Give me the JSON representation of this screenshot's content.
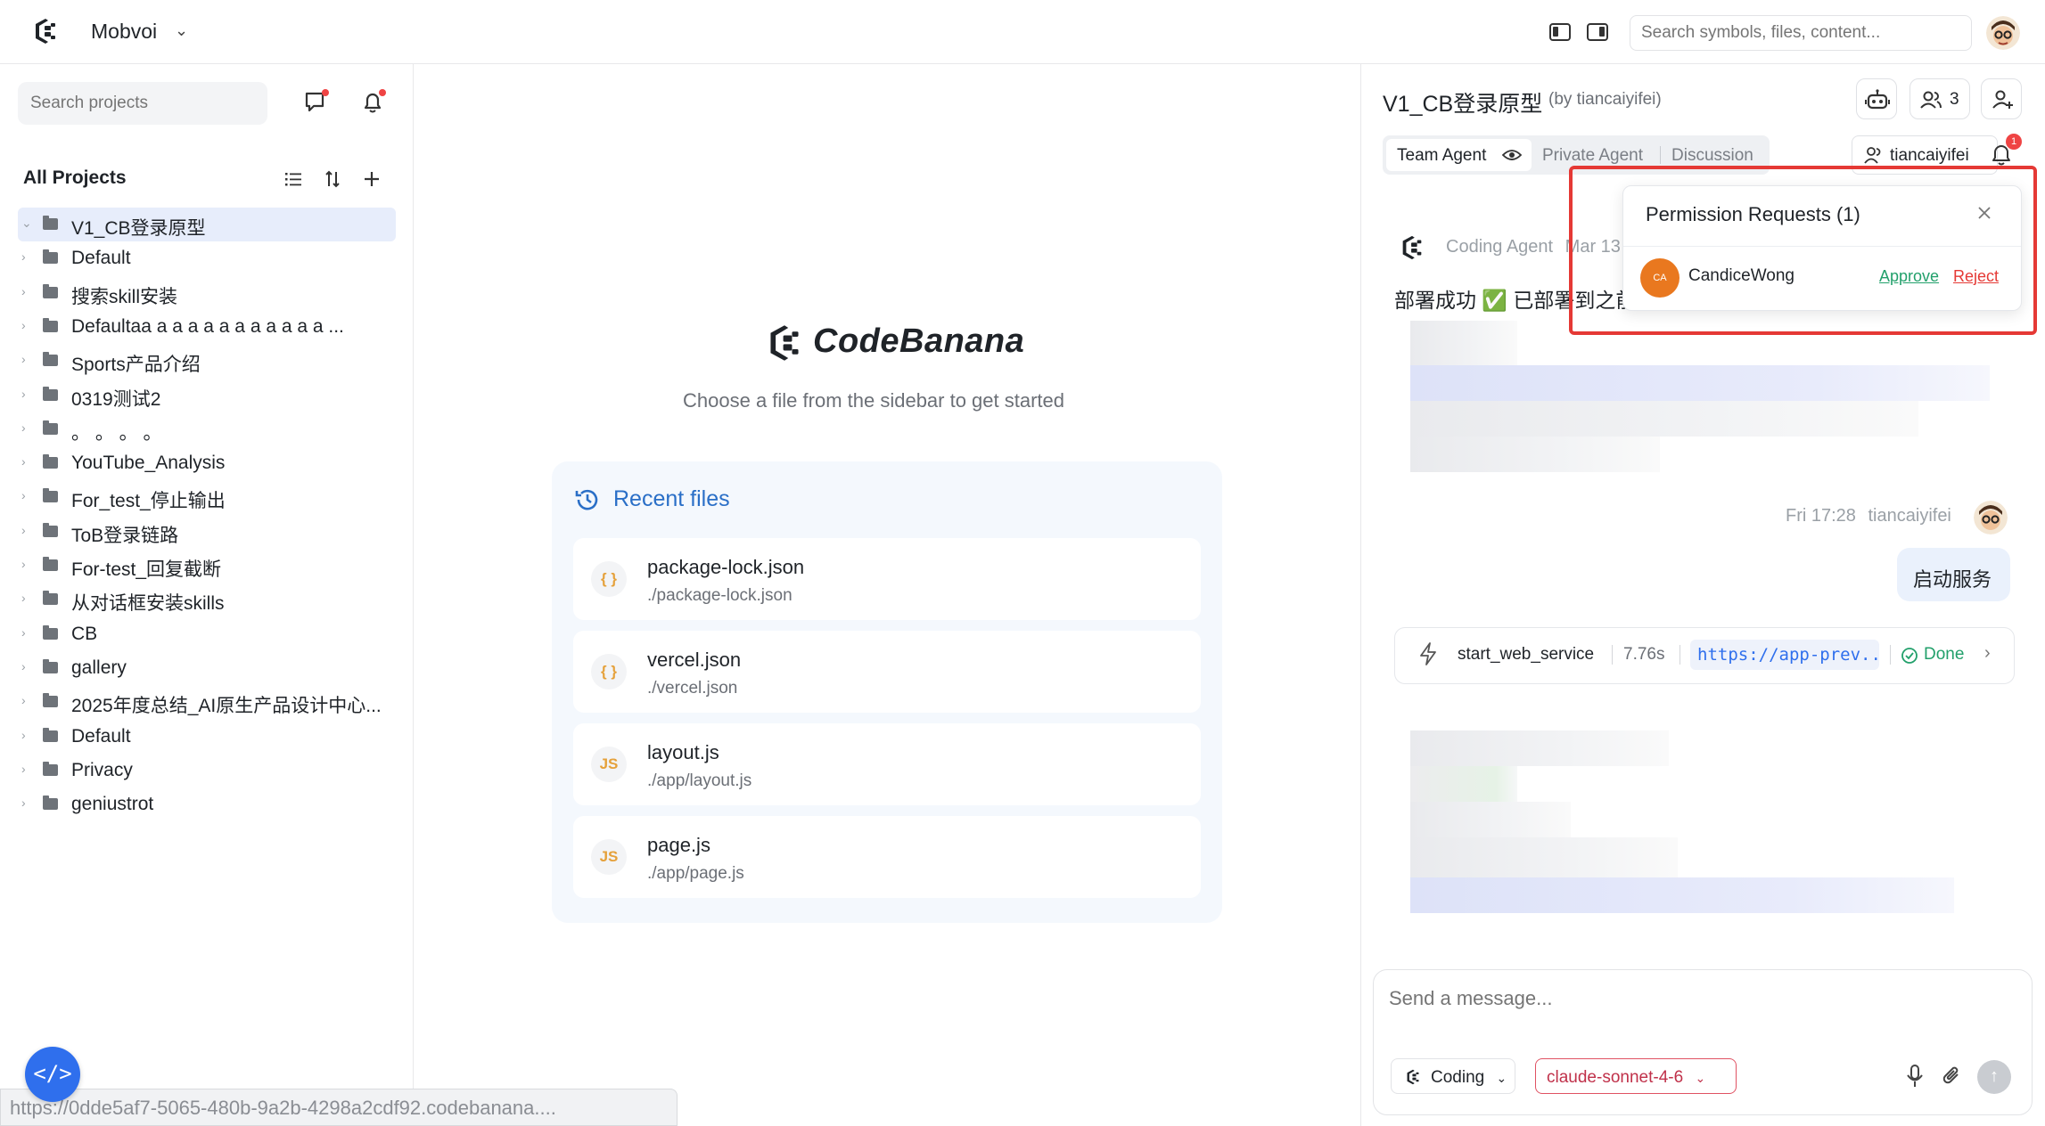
{
  "app": {
    "workspace_name": "Mobvoi",
    "global_search_placeholder": "Search symbols, files, content..."
  },
  "sidebar": {
    "search_placeholder": "Search projects",
    "section_title": "All Projects",
    "projects": [
      {
        "name": "V1_CB登录原型",
        "selected": true
      },
      {
        "name": "Default"
      },
      {
        "name": "搜索skill安装"
      },
      {
        "name": "Defaultaa a a a a a a a a a a a ..."
      },
      {
        "name": "Sports产品介绍"
      },
      {
        "name": "0319测试2"
      },
      {
        "name": "。 。 。 。"
      },
      {
        "name": "YouTube_Analysis"
      },
      {
        "name": "For_test_停止输出"
      },
      {
        "name": "ToB登录链路"
      },
      {
        "name": "For-test_回复截断"
      },
      {
        "name": "从对话框安装skills"
      },
      {
        "name": "CB"
      },
      {
        "name": "gallery"
      },
      {
        "name": "2025年度总结_AI原生产品设计中心..."
      },
      {
        "name": "Default"
      },
      {
        "name": "Privacy"
      },
      {
        "name": "geniustrot"
      }
    ],
    "status_url": "https://0dde5af7-5065-480b-9a2b-4298a2cdf92.codebanana...."
  },
  "center": {
    "brand_name": "CodeBanana",
    "subtitle": "Choose a file from the sidebar to get started",
    "recent_title": "Recent files",
    "recent_files": [
      {
        "icon": "{ }",
        "name": "package-lock.json",
        "path": "./package-lock.json"
      },
      {
        "icon": "{ }",
        "name": "vercel.json",
        "path": "./vercel.json"
      },
      {
        "icon": "JS",
        "name": "layout.js",
        "path": "./app/layout.js"
      },
      {
        "icon": "JS",
        "name": "page.js",
        "path": "./app/page.js"
      }
    ]
  },
  "right": {
    "project_title": "V1_CB登录原型",
    "project_by": "(by tiancaiyifei)",
    "member_count": "3",
    "tabs": {
      "team": "Team Agent",
      "private": "Private Agent",
      "discussion": "Discussion"
    },
    "user_chip": "tiancaiyifei",
    "notification_count": "1",
    "agent_name": "Coding Agent",
    "agent_time": "Mar 13",
    "agent_message": "部署成功 ✅ 已部署到之前",
    "user_meta_time": "Fri 17:28",
    "user_meta_name": "tiancaiyifei",
    "user_message": "启动服务",
    "tool": {
      "name": "start_web_service",
      "time": "7.76s",
      "url": "https://app-prev...",
      "status": "Done"
    },
    "composer_placeholder": "Send a message...",
    "mode": "Coding",
    "model": "claude-sonnet-4-6"
  },
  "permission_popup": {
    "title": "Permission Requests (1)",
    "user_initials": "CA",
    "user_name": "CandiceWong",
    "approve_label": "Approve",
    "reject_label": "Reject"
  },
  "colors": {
    "accent_blue": "#2f6fed",
    "approve_green": "#22a06b",
    "reject_red": "#e53935",
    "highlight_red": "#e53935"
  }
}
